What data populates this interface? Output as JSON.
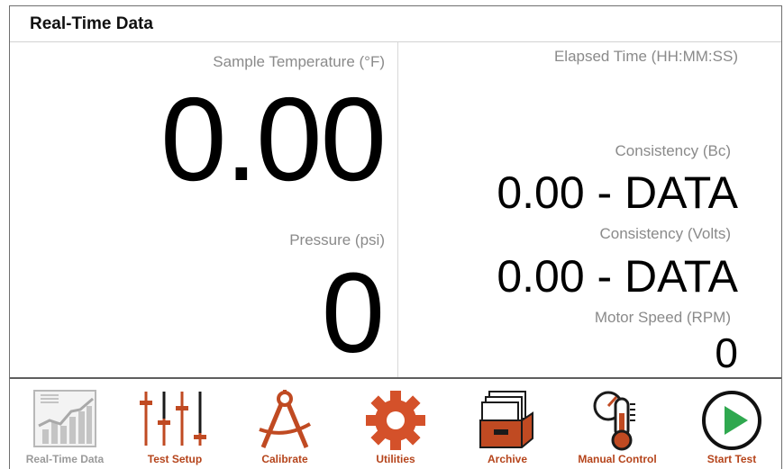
{
  "header": {
    "title": "Real-Time Data"
  },
  "readings": {
    "temperature": {
      "label": "Sample Temperature (°F)",
      "value": "0.00"
    },
    "pressure": {
      "label": "Pressure (psi)",
      "value": "0"
    },
    "elapsed_time": {
      "label": "Elapsed Time (HH:MM:SS)"
    },
    "consistency_bc": {
      "label": "Consistency (Bc)",
      "value": "0.00 - DATA"
    },
    "consistency_volts": {
      "label": "Consistency (Volts)",
      "value": "0.00 - DATA"
    },
    "motor_speed": {
      "label": "Motor Speed (RPM)",
      "value": "0"
    }
  },
  "toolbar": {
    "items": [
      {
        "label": "Real-Time Data",
        "icon": "line-chart-icon",
        "state": "active-disabled"
      },
      {
        "label": "Test Setup",
        "icon": "sliders-icon"
      },
      {
        "label": "Calibrate",
        "icon": "compass-icon"
      },
      {
        "label": "Utilities",
        "icon": "gear-icon"
      },
      {
        "label": "Archive",
        "icon": "file-box-icon"
      },
      {
        "label": "Manual Control",
        "icon": "thermometer-gauge-icon"
      },
      {
        "label": "Start Test",
        "icon": "play-icon"
      }
    ]
  },
  "colors": {
    "accent": "#d4512a",
    "label_gray": "#8a8a8a",
    "play_green": "#2fa84f",
    "disabled_gray": "#9a9a9a"
  }
}
